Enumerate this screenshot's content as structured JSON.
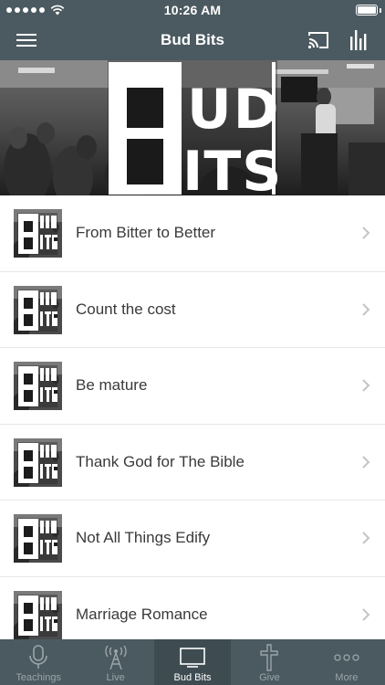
{
  "status_bar": {
    "time": "10:26 AM"
  },
  "nav": {
    "title": "Bud Bits"
  },
  "banner": {
    "logo_text": "BUD BITS"
  },
  "list": {
    "items": [
      {
        "title": "From Bitter to Better"
      },
      {
        "title": "Count the cost"
      },
      {
        "title": "Be mature"
      },
      {
        "title": "Thank God for The Bible"
      },
      {
        "title": "Not All Things Edify"
      },
      {
        "title": "Marriage Romance"
      }
    ]
  },
  "tab_bar": {
    "tabs": [
      {
        "label": "Teachings",
        "icon": "microphone-icon",
        "active": false
      },
      {
        "label": "Live",
        "icon": "broadcast-tower-icon",
        "active": false
      },
      {
        "label": "Bud Bits",
        "icon": "tv-icon",
        "active": true
      },
      {
        "label": "Give",
        "icon": "cross-icon",
        "active": false
      },
      {
        "label": "More",
        "icon": "more-dots-icon",
        "active": false
      }
    ]
  },
  "colors": {
    "bar_background": "#4b5a60",
    "active_tab_background": "#3e4c52",
    "inactive_tab": "#9aa5aa"
  }
}
